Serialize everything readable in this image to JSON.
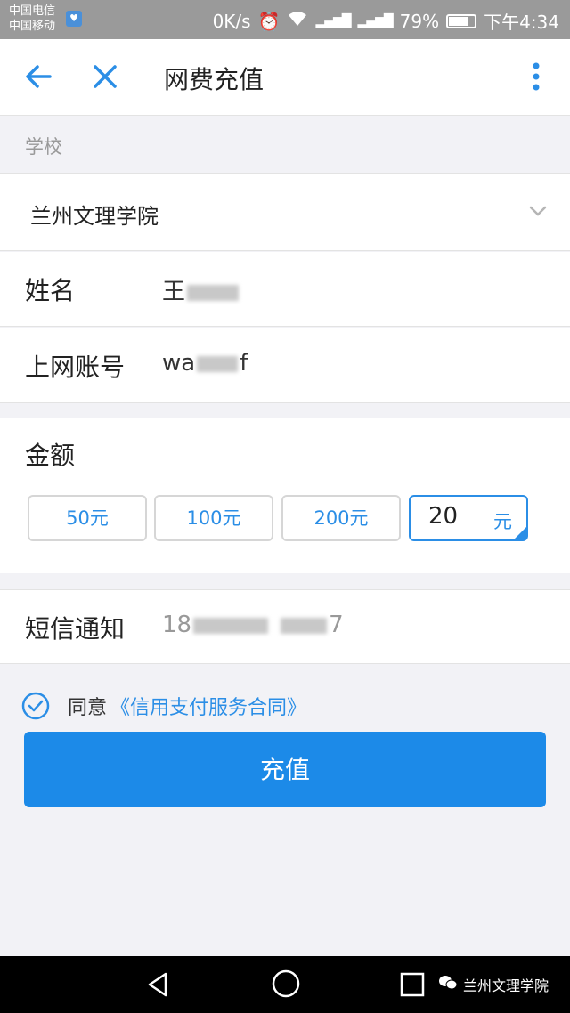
{
  "status_bar": {
    "carrier1": "中国电信",
    "carrier2": "中国移动",
    "speed": "0K/s",
    "battery": "79%",
    "battery_level": 0.79,
    "time": "下午4:34"
  },
  "app_bar": {
    "title": "网费充值"
  },
  "school": {
    "header": "学校",
    "selected": "兰州文理学院"
  },
  "fields": {
    "name_label": "姓名",
    "name_value": "王",
    "account_label": "上网账号",
    "account_prefix": "wa",
    "account_suffix": "f",
    "sms_label": "短信通知",
    "sms_prefix": "18",
    "sms_suffix": "7"
  },
  "amount": {
    "label": "金额",
    "options": [
      "50元",
      "100元",
      "200元"
    ],
    "custom_value": "20",
    "custom_unit": "元"
  },
  "agreement": {
    "text": "同意",
    "link": "《信用支付服务合同》"
  },
  "submit_label": "充值",
  "watermark": "兰州文理学院",
  "colors": {
    "accent": "#1c8ae8",
    "link": "#2b8ee6"
  }
}
